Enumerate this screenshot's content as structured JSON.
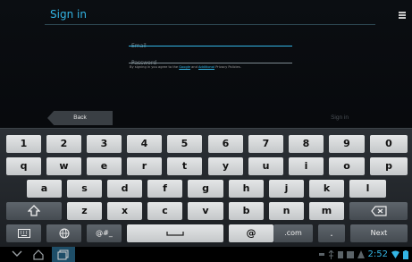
{
  "action_bar": {
    "title": "Sign in"
  },
  "form": {
    "email_placeholder": "Email",
    "password_placeholder": "Password",
    "terms": {
      "prefix": "By signing in you agree to the ",
      "link1": "Google",
      "mid": " and ",
      "link2": "Additional",
      "suffix": " Privacy Policies."
    },
    "back_label": "Back",
    "signin_label": "Sign in"
  },
  "keyboard": {
    "row1": [
      "1",
      "2",
      "3",
      "4",
      "5",
      "6",
      "7",
      "8",
      "9",
      "0"
    ],
    "row2": [
      "q",
      "w",
      "e",
      "r",
      "t",
      "y",
      "u",
      "i",
      "o",
      "p"
    ],
    "row3": [
      "a",
      "s",
      "d",
      "f",
      "g",
      "h",
      "j",
      "k",
      "l"
    ],
    "row4": [
      "z",
      "x",
      "c",
      "v",
      "b",
      "n",
      "m"
    ],
    "symbols_label": "@#_",
    "at_label": "@",
    "com_label": ".com",
    "period_label": ".",
    "next_label": "Next"
  },
  "system_bar": {
    "time": "2:52"
  },
  "colors": {
    "accent": "#33b5e5",
    "key_light": "#d8dadb",
    "key_dark": "#50575d"
  }
}
